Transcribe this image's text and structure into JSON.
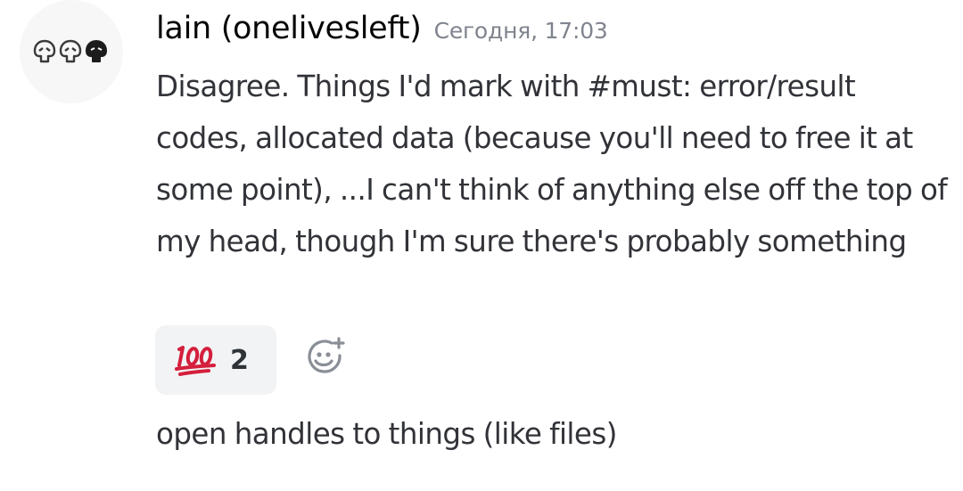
{
  "author": {
    "name": "lain (onelivesleft)",
    "avatar_icon": "trio-heads-icon"
  },
  "timestamp": "Сегодня, 17:03",
  "messages": [
    {
      "text": "Disagree. Things I'd mark with #must: error/result codes, allocated data (because you'll need to free it at some point), ...I can't think of anything else off the top of my head, though I'm sure there's probably something"
    },
    {
      "text": "open handles to things (like files)"
    }
  ],
  "reactions": [
    {
      "emoji": "hundred-points-icon",
      "count": "2"
    }
  ],
  "add_reaction_icon": "add-reaction-smiley-icon",
  "colors": {
    "username": "#060607",
    "timestamp": "#80848e",
    "text": "#313338",
    "reaction_bg": "#f2f3f5",
    "hundred_red": "#d41f3c"
  }
}
